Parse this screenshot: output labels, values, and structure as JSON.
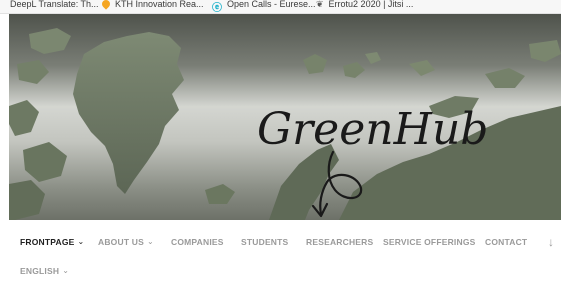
{
  "bookmarks": [
    {
      "label": "DeepL Translate: Th...",
      "icon": "deepl-icon"
    },
    {
      "label": "KTH Innovation Rea...",
      "icon": "flame-icon"
    },
    {
      "label": "Open Calls - Eurese...",
      "icon": "wave-icon"
    },
    {
      "label": "Errotu2 2020 | Jitsi ...",
      "icon": "jitsi-icon"
    }
  ],
  "hero": {
    "logo_text": "GreenHub",
    "colors": {
      "sky_top": "#585c55",
      "sky_mid": "#c9cbc6",
      "land": "#6f7a66",
      "sea": "#8b8f86"
    }
  },
  "nav": {
    "items": [
      {
        "label": "FRONTPAGE",
        "has_caret": true,
        "active": true
      },
      {
        "label": "ABOUT US",
        "has_caret": true,
        "active": false
      },
      {
        "label": "COMPANIES",
        "has_caret": false,
        "active": false
      },
      {
        "label": "STUDENTS",
        "has_caret": false,
        "active": false
      },
      {
        "label": "RESEARCHERS",
        "has_caret": false,
        "active": false
      },
      {
        "label": "SERVICE OFFERINGS",
        "has_caret": false,
        "active": false
      },
      {
        "label": "CONTACT",
        "has_caret": false,
        "active": false
      },
      {
        "label": "ENGLISH",
        "has_caret": true,
        "active": false
      }
    ],
    "caret_glyph": "⌄",
    "scroll_arrow": "↓"
  }
}
